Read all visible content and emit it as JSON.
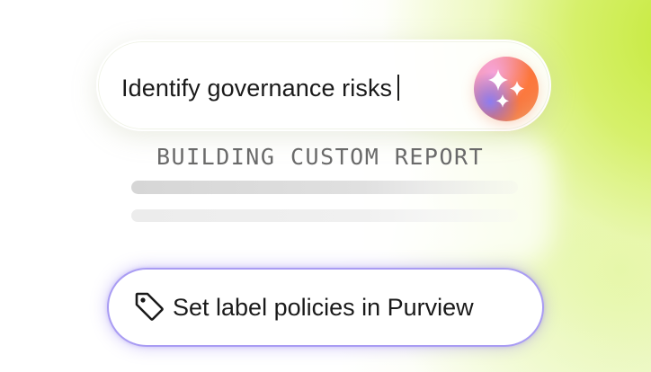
{
  "prompt": {
    "text": "Identify governance risks"
  },
  "ai_button": {
    "icon": "sparkles-icon"
  },
  "status": {
    "text": "BUILDING CUSTOM REPORT"
  },
  "suggestion": {
    "icon": "tag-icon",
    "label": "Set label policies in Purview"
  },
  "colors": {
    "accent_lime": "#c6ea3c",
    "suggestion_border": "#a99cf3",
    "orb_orange": "#f26b3a",
    "orb_pink": "#f5a5c8",
    "orb_purple": "#8d7cf0",
    "text_dark": "#1a1a1a",
    "status_gray": "#6a6a6a"
  }
}
